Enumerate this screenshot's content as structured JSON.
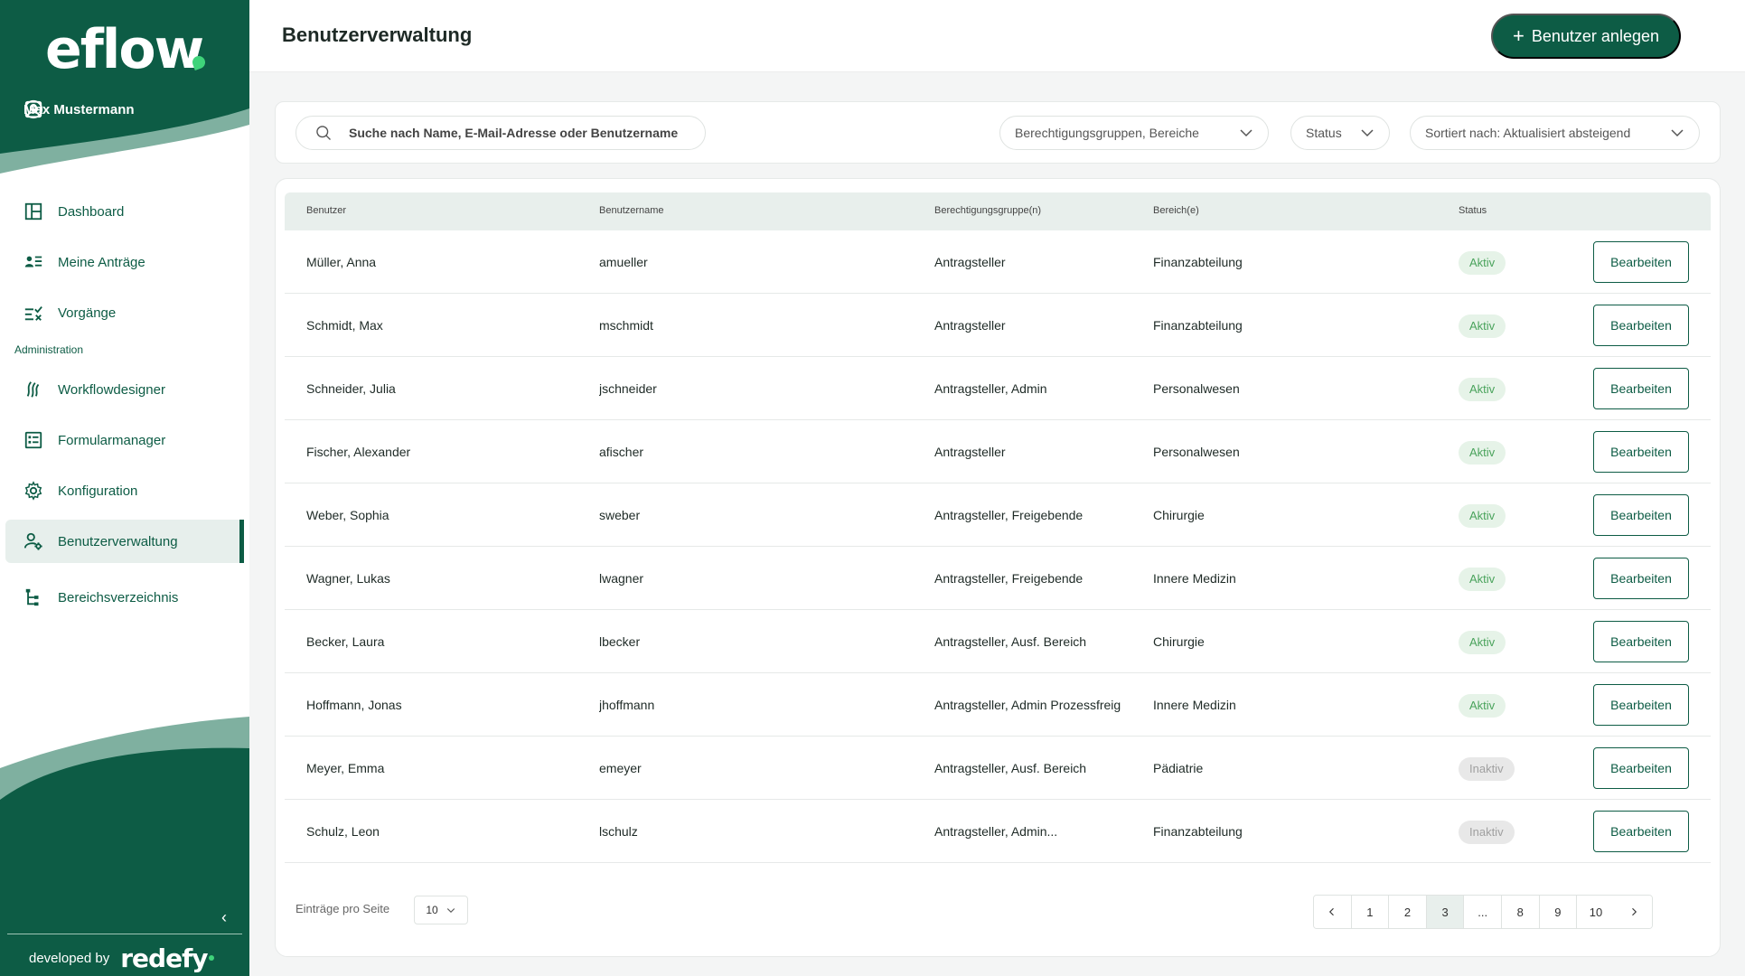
{
  "sidebar": {
    "logo": "eflow",
    "user_name": "Max Mustermann",
    "nav": [
      {
        "label": "Dashboard",
        "icon": "dashboard-icon"
      },
      {
        "label": "Meine Anträge",
        "icon": "my-requests-icon"
      },
      {
        "label": "Vorgänge",
        "icon": "tasks-icon"
      },
      {
        "label": "Workflowdesigner",
        "icon": "workflow-icon"
      },
      {
        "label": "Formularmanager",
        "icon": "form-icon"
      },
      {
        "label": "Konfiguration",
        "icon": "gear-icon"
      },
      {
        "label": "Benutzerverwaltung",
        "icon": "user-settings-icon"
      },
      {
        "label": "Bereichsverzeichnis",
        "icon": "tree-icon"
      }
    ],
    "section_admin": "Administration",
    "active_item": "Benutzerverwaltung",
    "developed_by": "developed by",
    "brand": "redefy"
  },
  "header": {
    "title": "Benutzerverwaltung",
    "add_button": "Benutzer anlegen"
  },
  "filters": {
    "search_placeholder": "Suche nach Name, E-Mail-Adresse oder Benutzername",
    "groups": "Berechtigungsgruppen, Bereiche",
    "status": "Status",
    "sort": "Sortiert nach: Aktualisiert absteigend"
  },
  "table": {
    "columns": [
      "Benutzer",
      "Benutzername",
      "Berechtigungsgruppe(n)",
      "Bereich(e)",
      "Status"
    ],
    "edit_label": "Bearbeiten",
    "rows": [
      {
        "name": "Müller, Anna",
        "username": "amueller",
        "groups": "Antragsteller",
        "area": "Finanzabteilung",
        "status": "Aktiv"
      },
      {
        "name": "Schmidt, Max",
        "username": "mschmidt",
        "groups": "Antragsteller",
        "area": "Finanzabteilung",
        "status": "Aktiv"
      },
      {
        "name": "Schneider, Julia",
        "username": "jschneider",
        "groups": "Antragsteller, Admin",
        "area": "Personalwesen",
        "status": "Aktiv"
      },
      {
        "name": "Fischer, Alexander",
        "username": "afischer",
        "groups": "Antragsteller",
        "area": "Personalwesen",
        "status": "Aktiv"
      },
      {
        "name": "Weber, Sophia",
        "username": "sweber",
        "groups": "Antragsteller, Freigebende",
        "area": "Chirurgie",
        "status": "Aktiv"
      },
      {
        "name": "Wagner, Lukas",
        "username": "lwagner",
        "groups": "Antragsteller, Freigebende",
        "area": "Innere Medizin",
        "status": "Aktiv"
      },
      {
        "name": "Becker, Laura",
        "username": "lbecker",
        "groups": "Antragsteller, Ausf. Bereich",
        "area": "Chirurgie",
        "status": "Aktiv"
      },
      {
        "name": "Hoffmann, Jonas",
        "username": "jhoffmann",
        "groups": "Antragsteller, Admin Prozessfreig",
        "area": "Innere Medizin",
        "status": "Aktiv"
      },
      {
        "name": "Meyer, Emma",
        "username": "emeyer",
        "groups": "Antragsteller, Ausf. Bereich",
        "area": "Pädiatrie",
        "status": "Inaktiv"
      },
      {
        "name": "Schulz, Leon",
        "username": "lschulz",
        "groups": "Antragsteller, Admin...",
        "area": "Finanzabteilung",
        "status": "Inaktiv"
      }
    ]
  },
  "pagination": {
    "per_page_label": "Einträge pro Seite",
    "per_page_value": "10",
    "pages": [
      "1",
      "2",
      "3",
      "...",
      "8",
      "9",
      "10"
    ],
    "current": "3"
  },
  "colors": {
    "brand_green": "#0d5c45",
    "accent_green": "#3fd37a",
    "active_badge": "#4aa35c"
  }
}
